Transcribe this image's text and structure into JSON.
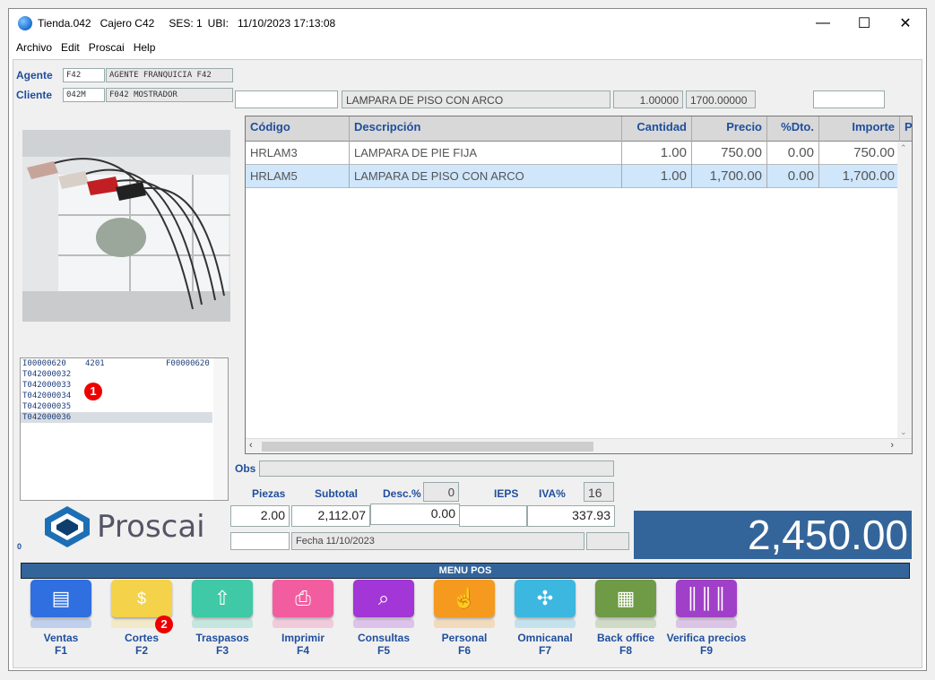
{
  "window": {
    "title_store": "Tienda.042",
    "title_cashier": "Cajero C42",
    "title_session": "SES: 1",
    "title_ubi": "UBI:",
    "title_datetime": "11/10/2023 17:13:08",
    "minimize": "—",
    "maximize": "☐",
    "close": "✕"
  },
  "menu": [
    "Archivo",
    "Edit",
    "Proscai",
    "Help"
  ],
  "agent": {
    "label": "Agente",
    "code": "F42",
    "name": "AGENTE FRANQUICIA F42"
  },
  "client": {
    "label": "Cliente",
    "code": "042M",
    "name": "F042 MOSTRADOR"
  },
  "entry": {
    "code": "",
    "description": "LAMPARA DE PISO CON ARCO",
    "quantity": "1.00000",
    "price": "1700.00000",
    "extra": ""
  },
  "grid": {
    "headers": [
      "Código",
      "Descripción",
      "Cantidad",
      "Precio",
      "%Dto.",
      "Importe",
      "P"
    ],
    "rows": [
      {
        "code": "HRLAM3",
        "description": "LAMPARA DE PIE FIJA",
        "quantity": "1.00",
        "price": "750.00",
        "discount": "0.00",
        "amount": "750.00"
      },
      {
        "code": "HRLAM5",
        "description": "LAMPARA DE PISO CON ARCO",
        "quantity": "1.00",
        "price": "1,700.00",
        "discount": "0.00",
        "amount": "1,700.00"
      }
    ]
  },
  "tickets": {
    "header_code": "I00000620",
    "header_num": "4201",
    "header_ref": "F00000620",
    "items": [
      "T042000032",
      "T042000033",
      "T042000034",
      "T042000035",
      "T042000036"
    ]
  },
  "badges": {
    "one": "1",
    "two": "2"
  },
  "logo": {
    "text": "Proscai"
  },
  "bottom_left_counter": "0",
  "obs": {
    "label": "Obs",
    "value": ""
  },
  "totals": {
    "pieces_label": "Piezas",
    "subtotal_label": "Subtotal",
    "desc_label": "Desc.%",
    "desc_pct": "0",
    "ieps_label": "IEPS",
    "iva_label": "IVA%",
    "iva_pct": "16",
    "pieces": "2.00",
    "subtotal": "2,112.07",
    "discount": "0.00",
    "ieps": "",
    "iva": "337.93",
    "date": "Fecha 11/10/2023",
    "total": "2,450.00"
  },
  "menu_pos_title": "MENU POS",
  "buttons": [
    {
      "name": "Ventas",
      "key": "F1",
      "color": "#2f6fe0",
      "icon": "receipt-icon"
    },
    {
      "name": "Cortes",
      "key": "F2",
      "color": "#f4d24a",
      "icon": "cash-icon"
    },
    {
      "name": "Traspasos",
      "key": "F3",
      "color": "#3fc9a6",
      "icon": "transfer-icon"
    },
    {
      "name": "Imprimir",
      "key": "F4",
      "color": "#f25da0",
      "icon": "printer-icon"
    },
    {
      "name": "Consultas",
      "key": "F5",
      "color": "#a236d6",
      "icon": "search-icon"
    },
    {
      "name": "Personal",
      "key": "F6",
      "color": "#f59a1e",
      "icon": "hand-icon"
    },
    {
      "name": "Omnicanal",
      "key": "F7",
      "color": "#3cb7e0",
      "icon": "network-icon"
    },
    {
      "name": "Back office",
      "key": "F8",
      "color": "#6f9a46",
      "icon": "building-icon"
    },
    {
      "name": "Verifica precios",
      "key": "F9",
      "color": "#a040c8",
      "icon": "barcode-icon"
    }
  ]
}
